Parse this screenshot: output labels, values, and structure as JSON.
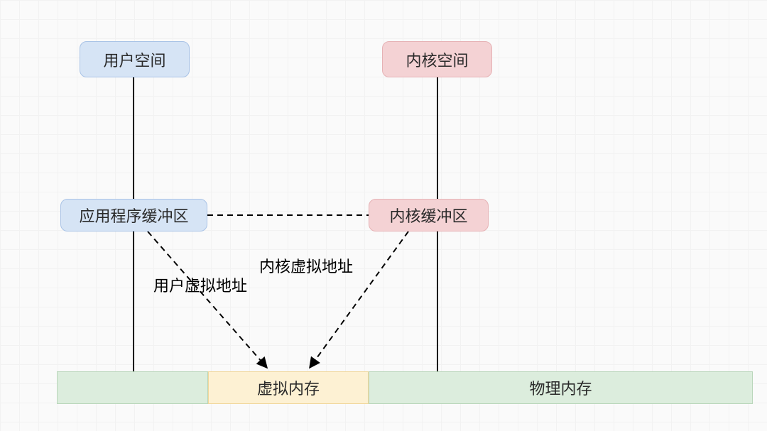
{
  "boxes": {
    "user_space": "用户空间",
    "kernel_space": "内核空间",
    "app_buffer": "应用程序缓冲区",
    "kernel_buffer": "内核缓冲区",
    "virtual_mem": "虚拟内存",
    "physical_mem": "物理内存"
  },
  "labels": {
    "user_virt_addr": "用户虚拟地址",
    "kernel_virt_addr": "内核虚拟地址"
  }
}
